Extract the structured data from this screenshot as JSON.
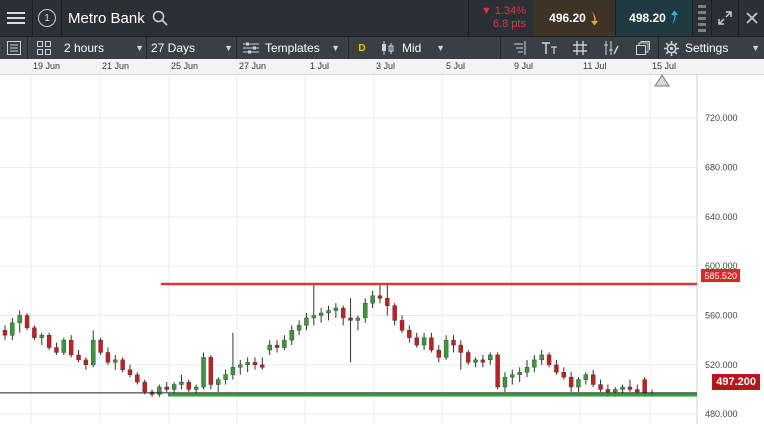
{
  "header": {
    "menu_icon": "hamburger-icon",
    "info_badge": "1",
    "instrument": "Metro Bank",
    "search_icon": "search-icon",
    "change_percent": "▼ 1.34%",
    "change_points": "6.8 pts",
    "sell_price": "496.20",
    "buy_price": "498.20",
    "colors": {
      "down": "#e0333b",
      "sell_bg": "#3d3327",
      "buy_bg": "#1f3a40",
      "sell_arrow": "#e8a33a",
      "buy_arrow": "#37b3d8"
    }
  },
  "toolbar": {
    "interval": "2 hours",
    "period": "27 Days",
    "templates_label": "Templates",
    "d_badge": "D",
    "price_type": "Mid",
    "settings_label": "Settings"
  },
  "date_axis": [
    "19 Jun",
    "21 Jun",
    "25 Jun",
    "27 Jun",
    "1 Jul",
    "3 Jul",
    "5 Jul",
    "9 Jul",
    "11 Jul",
    "15 Jul"
  ],
  "price_axis": [
    "720.000",
    "680.000",
    "640.000",
    "600.000",
    "560.000",
    "520.000",
    "480.000"
  ],
  "price_levels": {
    "resistance": "585.520",
    "current": "497.200"
  },
  "chart_data": {
    "type": "candlestick",
    "instrument": "Metro Bank",
    "interval": "2 hours",
    "x_labels": [
      "19 Jun",
      "21 Jun",
      "25 Jun",
      "27 Jun",
      "1 Jul",
      "3 Jul",
      "5 Jul",
      "9 Jul",
      "11 Jul",
      "15 Jul"
    ],
    "y_ticks": [
      720,
      680,
      640,
      600,
      560,
      520,
      480
    ],
    "ylim": [
      472,
      755
    ],
    "horizontal_lines": [
      {
        "value": 585.52,
        "color": "#e0333b"
      },
      {
        "value": 495.5,
        "color": "#2e9e3a"
      },
      {
        "value": 497.2,
        "color": "#222222"
      }
    ],
    "up_color": "#3a9a3a",
    "down_color": "#c42020",
    "candles": [
      [
        548,
        552,
        540,
        544
      ],
      [
        544,
        558,
        540,
        554
      ],
      [
        554,
        564,
        546,
        560
      ],
      [
        560,
        562,
        548,
        550
      ],
      [
        550,
        552,
        540,
        542
      ],
      [
        542,
        546,
        536,
        544
      ],
      [
        544,
        546,
        532,
        534
      ],
      [
        534,
        538,
        528,
        530
      ],
      [
        530,
        542,
        528,
        540
      ],
      [
        540,
        544,
        526,
        528
      ],
      [
        528,
        532,
        522,
        524
      ],
      [
        524,
        526,
        516,
        520
      ],
      [
        520,
        548,
        518,
        540
      ],
      [
        540,
        542,
        528,
        530
      ],
      [
        530,
        534,
        520,
        522
      ],
      [
        522,
        528,
        516,
        524
      ],
      [
        524,
        526,
        514,
        516
      ],
      [
        516,
        520,
        510,
        512
      ],
      [
        512,
        514,
        504,
        506
      ],
      [
        506,
        508,
        496,
        498
      ],
      [
        498,
        500,
        494,
        496
      ],
      [
        496,
        504,
        494,
        502
      ],
      [
        502,
        506,
        498,
        500
      ],
      [
        500,
        506,
        496,
        504
      ],
      [
        504,
        512,
        500,
        506
      ],
      [
        506,
        508,
        498,
        500
      ],
      [
        500,
        504,
        496,
        502
      ],
      [
        502,
        530,
        500,
        526
      ],
      [
        526,
        528,
        500,
        504
      ],
      [
        504,
        510,
        498,
        508
      ],
      [
        508,
        516,
        504,
        512
      ],
      [
        512,
        546,
        508,
        518
      ],
      [
        518,
        524,
        512,
        520
      ],
      [
        520,
        526,
        514,
        522
      ],
      [
        522,
        526,
        516,
        520
      ],
      [
        520,
        526,
        516,
        518
      ],
      [
        532,
        540,
        528,
        536
      ],
      [
        536,
        540,
        530,
        534
      ],
      [
        534,
        544,
        532,
        540
      ],
      [
        540,
        552,
        536,
        548
      ],
      [
        548,
        556,
        544,
        552
      ],
      [
        552,
        562,
        548,
        558
      ],
      [
        558,
        586,
        552,
        560
      ],
      [
        560,
        566,
        554,
        562
      ],
      [
        562,
        568,
        556,
        564
      ],
      [
        564,
        570,
        558,
        566
      ],
      [
        566,
        568,
        552,
        558
      ],
      [
        558,
        574,
        522,
        556
      ],
      [
        556,
        560,
        548,
        558
      ],
      [
        558,
        574,
        554,
        570
      ],
      [
        570,
        580,
        566,
        576
      ],
      [
        576,
        586,
        570,
        574
      ],
      [
        574,
        586,
        560,
        568
      ],
      [
        568,
        570,
        552,
        556
      ],
      [
        556,
        560,
        546,
        548
      ],
      [
        548,
        552,
        538,
        542
      ],
      [
        542,
        546,
        534,
        536
      ],
      [
        536,
        546,
        532,
        542
      ],
      [
        542,
        546,
        530,
        532
      ],
      [
        532,
        536,
        522,
        526
      ],
      [
        526,
        544,
        524,
        540
      ],
      [
        540,
        544,
        530,
        536
      ],
      [
        536,
        540,
        516,
        530
      ],
      [
        530,
        532,
        520,
        522
      ],
      [
        522,
        526,
        518,
        524
      ],
      [
        524,
        528,
        518,
        522
      ],
      [
        524,
        530,
        520,
        528
      ],
      [
        528,
        530,
        500,
        502
      ],
      [
        502,
        514,
        498,
        510
      ],
      [
        510,
        516,
        504,
        512
      ],
      [
        512,
        518,
        506,
        514
      ],
      [
        514,
        524,
        510,
        518
      ],
      [
        518,
        528,
        514,
        524
      ],
      [
        524,
        532,
        520,
        528
      ],
      [
        528,
        530,
        518,
        520
      ],
      [
        520,
        524,
        512,
        514
      ],
      [
        514,
        518,
        508,
        510
      ],
      [
        510,
        514,
        498,
        502
      ],
      [
        502,
        510,
        498,
        508
      ],
      [
        508,
        514,
        504,
        512
      ],
      [
        512,
        516,
        502,
        504
      ],
      [
        504,
        508,
        498,
        500
      ],
      [
        500,
        504,
        494,
        498
      ],
      [
        498,
        502,
        494,
        500
      ],
      [
        500,
        504,
        496,
        502
      ],
      [
        502,
        508,
        498,
        500
      ],
      [
        500,
        504,
        496,
        498
      ],
      [
        508,
        510,
        494,
        496
      ],
      [
        496,
        500,
        494,
        497
      ]
    ]
  }
}
